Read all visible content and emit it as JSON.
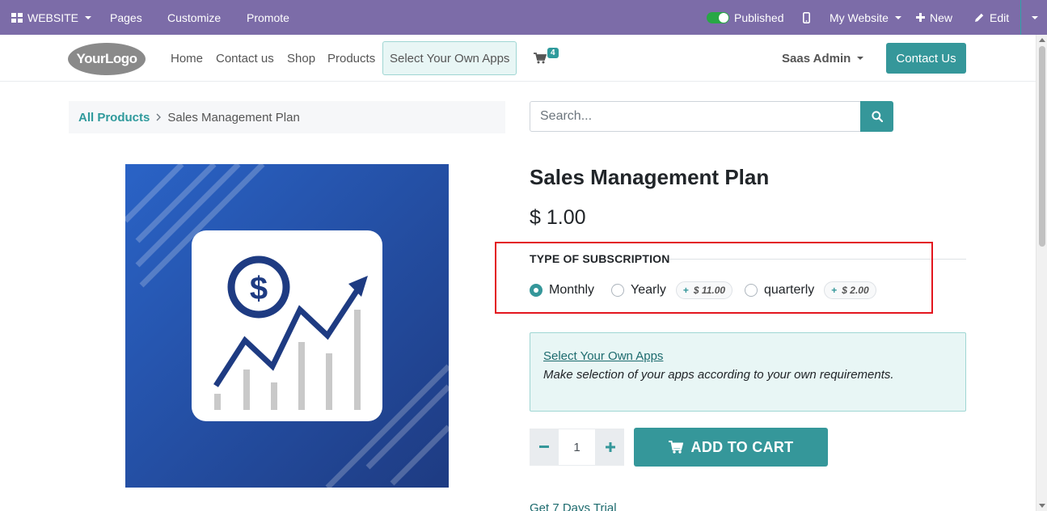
{
  "admin_bar": {
    "website_label": "WEBSITE",
    "pages_label": "Pages",
    "customize_label": "Customize",
    "promote_label": "Promote",
    "published_label": "Published",
    "my_website_label": "My Website",
    "new_label": "New",
    "edit_label": "Edit"
  },
  "nav": {
    "logo_text": "YourLogo",
    "links": [
      "Home",
      "Contact us",
      "Shop",
      "Products",
      "Select Your Own Apps"
    ],
    "cart_count": "4",
    "user_name": "Saas Admin",
    "contact_button": "Contact Us"
  },
  "breadcrumb": {
    "root": "All Products",
    "current": "Sales Management Plan"
  },
  "search": {
    "placeholder": "Search..."
  },
  "product": {
    "title": "Sales Management Plan",
    "price": "$ 1.00",
    "subscription_label": "TYPE OF SUBSCRIPTION",
    "options": [
      {
        "label": "Monthly",
        "extra": "",
        "checked": true
      },
      {
        "label": "Yearly",
        "extra": "$ 11.00",
        "checked": false
      },
      {
        "label": "quarterly",
        "extra": "$ 2.00",
        "checked": false
      }
    ],
    "extra_prefix": "+",
    "info_link": "Select Your Own Apps",
    "info_text": "Make selection of your apps according to your own requirements.",
    "quantity": "1",
    "add_to_cart": "ADD TO CART",
    "trial_link": "Get 7 Days Trial"
  },
  "colors": {
    "admin_bar": "#7c6ca8",
    "primary": "#35979a",
    "highlight_border": "#e3161e",
    "image_bg_top": "#2a63c6",
    "image_bg_bottom": "#1e3b82"
  }
}
